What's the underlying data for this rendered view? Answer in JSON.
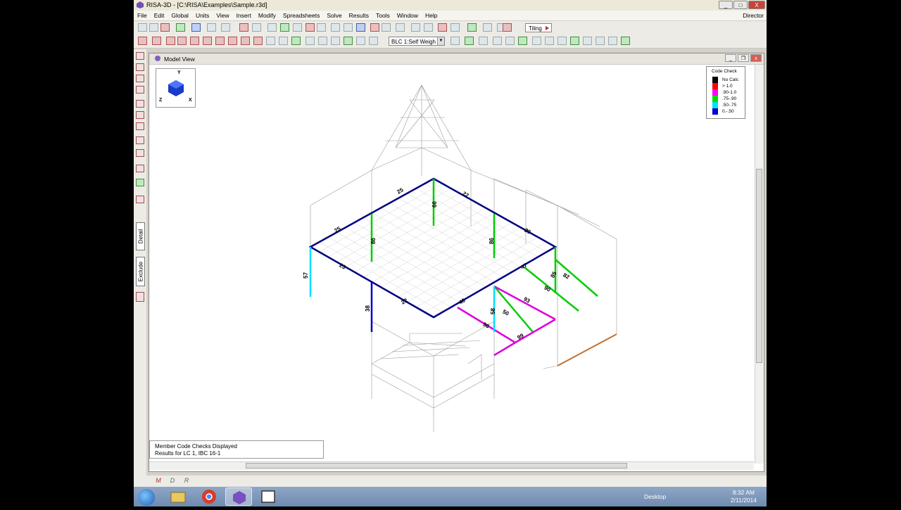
{
  "window": {
    "title": "RISA-3D - [C:\\RISA\\Examples\\Sample.r3d]",
    "min": "_",
    "max": "□",
    "close": "X"
  },
  "menu": {
    "items": [
      "File",
      "Edit",
      "Global",
      "Units",
      "View",
      "Insert",
      "Modify",
      "Spreadsheets",
      "Solve",
      "Results",
      "Tools",
      "Window",
      "Help"
    ],
    "director": "Director"
  },
  "toolbar": {
    "tiling_label": "Tiling",
    "blc_select": "BLC 1:Self Weigh"
  },
  "side_tabs": {
    "detail": "Detail",
    "exclude": "Exclude"
  },
  "model_view": {
    "title": "Model View",
    "axes": {
      "y": "Y",
      "x": "X",
      "z": "Z"
    },
    "legend": {
      "title": "Code Check",
      "entries": [
        {
          "label": "No Calc",
          "color": "#000000"
        },
        {
          "label": "> 1.0",
          "color": "#ff0000"
        },
        {
          "label": ".90-1.0",
          "color": "#ff00ff"
        },
        {
          "label": ".75-.90",
          "color": "#00dd00"
        },
        {
          "label": ".50-.75",
          "color": "#00e0ff"
        },
        {
          "label": "0.-.50",
          "color": "#0000cc"
        }
      ]
    },
    "status_line1": "Member Code Checks Displayed",
    "status_line2": "Results for LC 1, IBC 16-1"
  },
  "member_labels": [
    "25",
    "22",
    "25",
    "20",
    "23",
    "47",
    "22",
    "40",
    "57",
    "38",
    "85",
    "82",
    "90",
    "93",
    "50",
    "96",
    "99",
    "66",
    "86",
    "86",
    "58"
  ],
  "bottom_tabs": [
    "M",
    "D",
    "R"
  ],
  "taskbar": {
    "desktop": "Desktop",
    "time": "8:32 AM",
    "date": "2/11/2014"
  }
}
